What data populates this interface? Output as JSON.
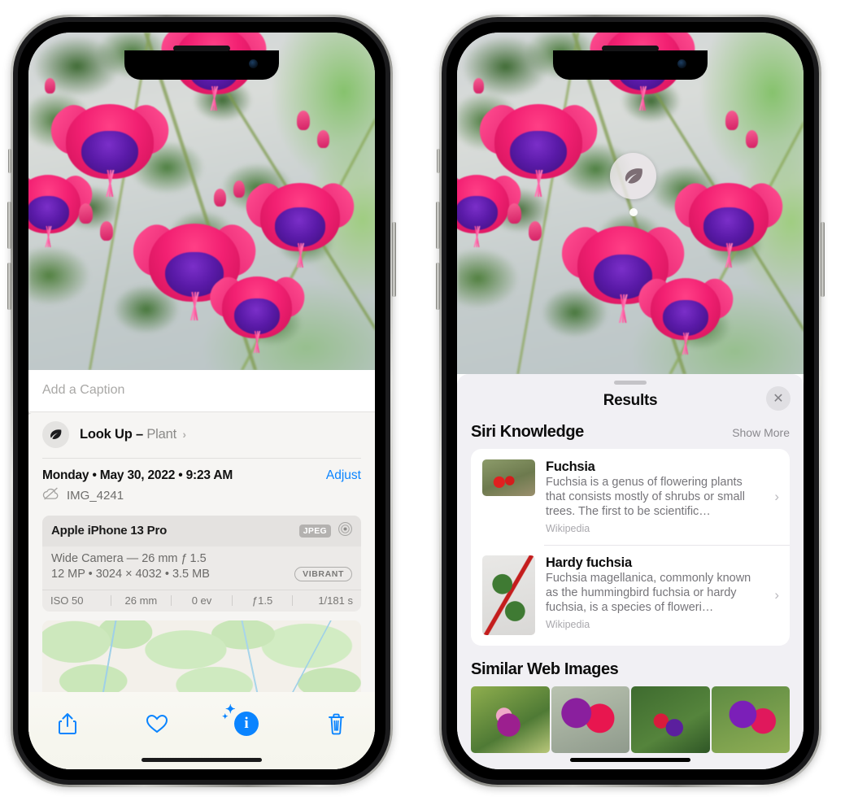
{
  "left_phone": {
    "caption": {
      "placeholder": "Add a Caption",
      "value": ""
    },
    "lookup": {
      "label": "Look Up –",
      "subject": "Plant",
      "chevron": "›",
      "icon": "leaf-icon"
    },
    "date_line": "Monday • May 30, 2022 • 9:23 AM",
    "adjust_label": "Adjust",
    "file_name": "IMG_4241",
    "file_icon": "cloud-slash-icon",
    "exif": {
      "device": "Apple iPhone 13 Pro",
      "format_badge": "JPEG",
      "format_icon": "aperture-icon",
      "lens_line": "Wide Camera — 26 mm ƒ 1.5",
      "size_line": "12 MP • 3024 × 4032 • 3.5 MB",
      "style_badge": "VIBRANT",
      "stats": [
        "ISO 50",
        "26 mm",
        "0 ev",
        "ƒ1.5",
        "1/181 s"
      ]
    },
    "toolbar": {
      "share_label": "share-icon",
      "favorite_label": "heart-icon",
      "info_label": "i",
      "delete_label": "trash-icon"
    }
  },
  "right_phone": {
    "visual_lookup_pin": {
      "icon": "leaf-icon"
    },
    "sheet": {
      "title": "Results",
      "close_label": "✕",
      "sections": [
        {
          "title": "Siri Knowledge",
          "action": "Show More",
          "entries": [
            {
              "title": "Fuchsia",
              "description": "Fuchsia is a genus of flowering plants that consists mostly of shrubs or small trees. The first to be scientific…",
              "source": "Wikipedia",
              "chevron": "›"
            },
            {
              "title": "Hardy fuchsia",
              "description": "Fuchsia magellanica, commonly known as the hummingbird fuchsia or hardy fuchsia, is a species of floweri…",
              "source": "Wikipedia",
              "chevron": "›"
            }
          ]
        },
        {
          "title": "Similar Web Images",
          "thumbnails": [
            "web-image-1",
            "web-image-2",
            "web-image-3",
            "web-image-4"
          ]
        }
      ]
    }
  },
  "colors": {
    "accent_blue": "#0a84ff",
    "sheet_bg_left": "#f6f5f3",
    "sheet_bg_right": "#f1f0f4",
    "card_white": "#ffffff",
    "secondary_text": "#76757a"
  }
}
